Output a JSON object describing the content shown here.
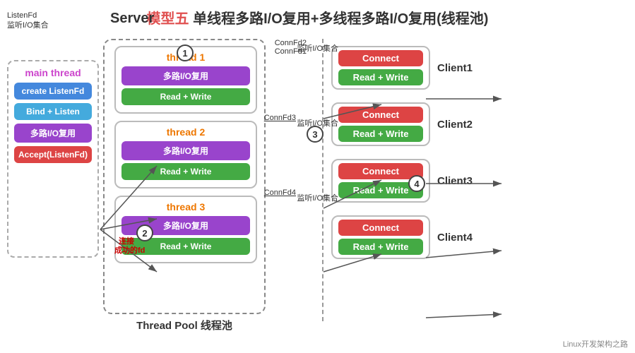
{
  "title": {
    "prefix": "模型五",
    "text": " 单线程多路I/O复用+多线程多路I/O复用(线程池)"
  },
  "server_label": "Server",
  "main_thread": {
    "label": "main thread",
    "listenfd": "ListenFd\n监听I/O集合",
    "buttons": [
      {
        "text": "create ListenFd",
        "color": "blue"
      },
      {
        "text": "Bind + Listen",
        "color": "blue2"
      },
      {
        "text": "多路I/O复用",
        "color": "purple"
      },
      {
        "text": "Accept(ListenFd)",
        "color": "red"
      }
    ]
  },
  "threads": [
    {
      "title": "thread 1",
      "rows": [
        "多路I/O复用",
        "Read + Write"
      ],
      "connfd_label": "ConnFd2\nConnFd1",
      "anno": "监听I/O集合"
    },
    {
      "title": "thread 2",
      "rows": [
        "多路I/O复用",
        "Read + Write"
      ],
      "connfd_label": "ConnFd3",
      "anno": "监听I/O集合"
    },
    {
      "title": "thread 3",
      "rows": [
        "多路I/O复用",
        "Read + Write"
      ],
      "connfd_label": "ConnFd4",
      "anno": "监听I/O集合"
    }
  ],
  "thread_pool_label": "Thread Pool 线程池",
  "clients": [
    {
      "name": "Client1",
      "connect": "Connect",
      "rw": "Read + Write"
    },
    {
      "name": "Client2",
      "connect": "Connect",
      "rw": "Read + Write"
    },
    {
      "name": "Client3",
      "connect": "Connect",
      "rw": "Read + Write"
    },
    {
      "name": "Client4",
      "connect": "Connect",
      "rw": "Read + Write"
    }
  ],
  "steps": [
    "1",
    "2",
    "3",
    "4"
  ],
  "annotation_lian": "连接\n成功的fd",
  "watermark": "Linux开发架构之路"
}
